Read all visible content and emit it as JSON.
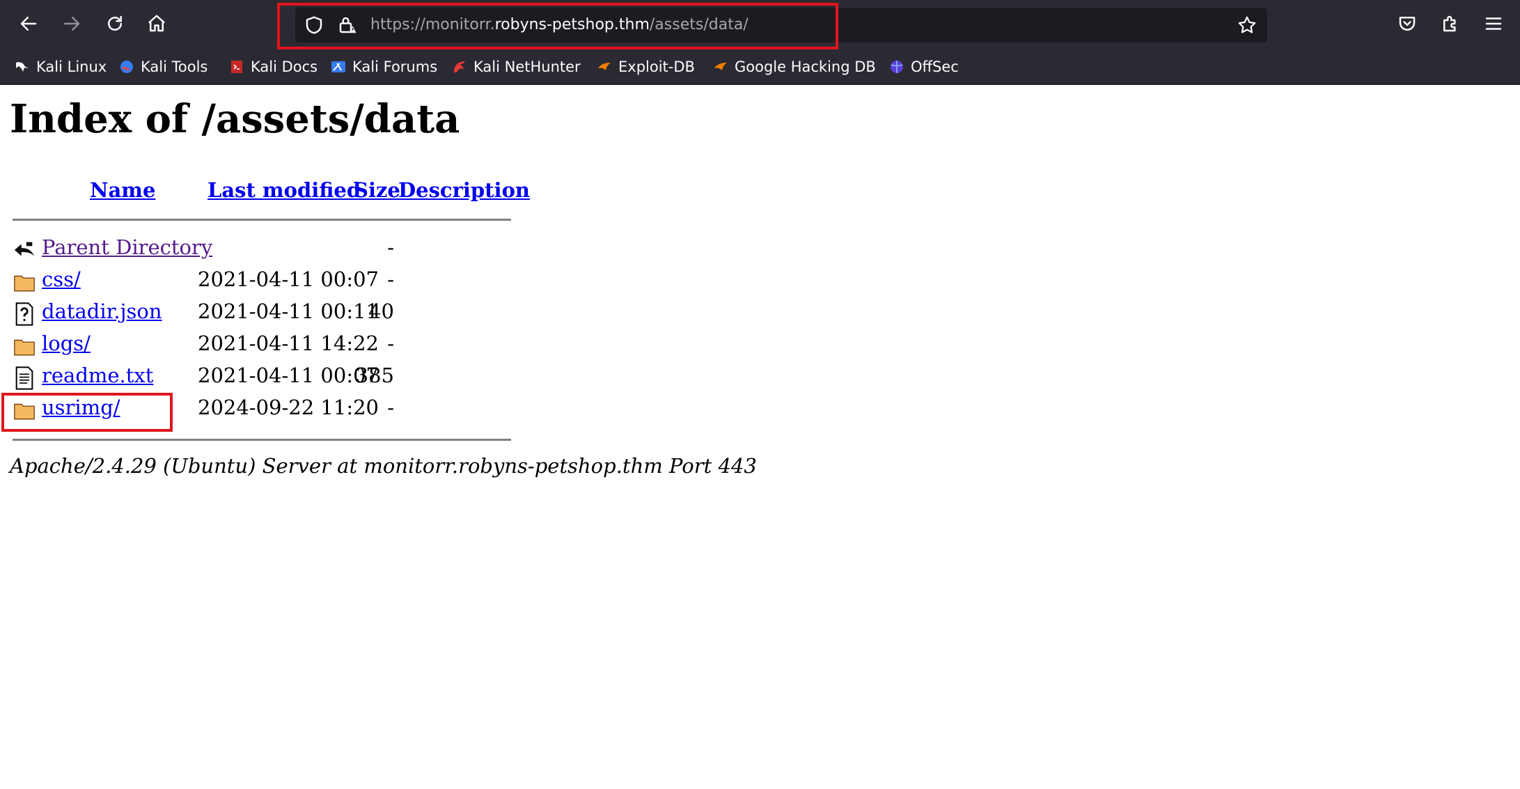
{
  "browser": {
    "url": {
      "scheme_prefix": "https://monitorr.",
      "host": "robyns-petshop.thm",
      "path": "/assets/data/"
    },
    "toolbar_icons": [
      "back-icon",
      "forward-icon",
      "reload-icon",
      "home-icon",
      "shield-icon",
      "lock-warning-icon",
      "star-icon",
      "pocket-icon",
      "extensions-icon",
      "menu-icon"
    ],
    "bookmarks": [
      {
        "label": "Kali Linux"
      },
      {
        "label": "Kali Tools"
      },
      {
        "label": "Kali Docs"
      },
      {
        "label": "Kali Forums"
      },
      {
        "label": "Kali NetHunter"
      },
      {
        "label": "Exploit-DB"
      },
      {
        "label": "Google Hacking DB"
      },
      {
        "label": "OffSec"
      }
    ]
  },
  "page": {
    "title": "Index of /assets/data",
    "columns": {
      "name": "Name",
      "last_modified": "Last modified",
      "size": "Size",
      "description": "Description"
    },
    "rows": [
      {
        "name": "Parent Directory",
        "modified": "",
        "size": "-",
        "icon": "back-arrow-icon"
      },
      {
        "name": "css/",
        "modified": "2021-04-11 00:07",
        "size": "-",
        "icon": "folder-icon"
      },
      {
        "name": "datadir.json",
        "modified": "2021-04-11 00:11",
        "size": "40",
        "icon": "unknown-file-icon"
      },
      {
        "name": "logs/",
        "modified": "2021-04-11 14:22",
        "size": "-",
        "icon": "folder-icon"
      },
      {
        "name": "readme.txt",
        "modified": "2021-04-11 00:07",
        "size": "385",
        "icon": "text-file-icon"
      },
      {
        "name": "usrimg/",
        "modified": "2024-09-22 11:20",
        "size": "-",
        "icon": "folder-icon"
      }
    ],
    "server_signature": "Apache/2.4.29 (Ubuntu) Server at monitorr.robyns-petshop.thm Port 443"
  },
  "colors": {
    "chrome_bg": "#2b2a33",
    "urlbar_bg": "#1c1b22",
    "link": "#0000ee",
    "visited_link": "#551a8b",
    "annotation": "#e0151d"
  }
}
